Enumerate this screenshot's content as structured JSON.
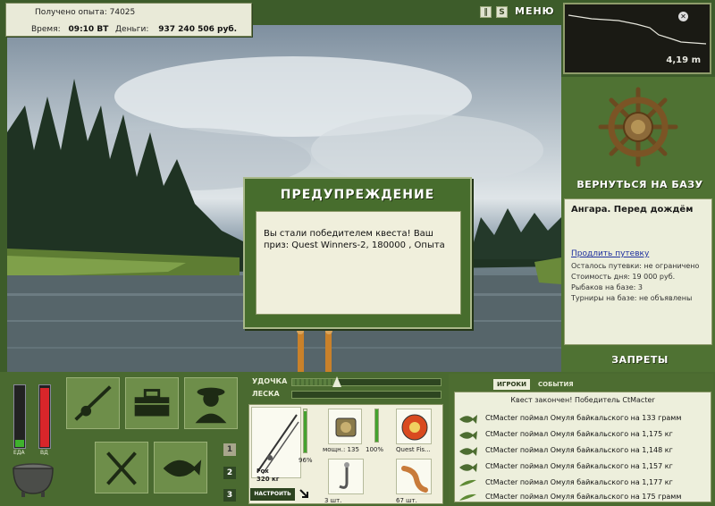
{
  "stats": {
    "exp_label": "Получено опыта:",
    "exp_value": "74025",
    "time_label": "Время:",
    "time_value": "09:10 ВТ",
    "money_label": "Деньги:",
    "money_value": "937 240 506 руб."
  },
  "top_menu": {
    "menu_label": "МЕНЮ",
    "pause_icon": "pause-icon",
    "sound_icon": "sound-icon"
  },
  "depth": {
    "value": "4,19 m"
  },
  "base": {
    "return_label": "ВЕРНУТЬСЯ НА БАЗУ",
    "location_title": "Ангара. Перед дождём",
    "extend_link": "Продлить путевку",
    "lines": [
      "Осталось путевки: не ограничено",
      "Стоимость дня: 19 000 руб.",
      "Рыбаков на базе: 3",
      "Турниры на базе: не объявлены"
    ],
    "bans_label": "ЗАПРЕТЫ"
  },
  "dialog": {
    "title": "ПРЕДУПРЕЖДЕНИЕ",
    "message": "Вы стали победителем квеста! Ваш приз: Quest Winners-2, 180000 , Опыта"
  },
  "gauges": {
    "food_label": "ЕДА",
    "vodka_label": "ВД",
    "food_level": 0.12,
    "vodka_level": 0.95
  },
  "page_buttons": [
    "1",
    "2",
    "3"
  ],
  "tackle": {
    "rod_label": "УДОЧКА",
    "line_label": "ЛЕСКА",
    "rod_tension": 0.3,
    "line_tension": 0.0,
    "rod_percent": "96%",
    "rod_name": "Fox",
    "rod_weight": "320 кг",
    "reel_power": "мощн.: 135",
    "reel_percent": "100%",
    "line_name": "Quest Fis...",
    "hook_count": "3 шт.",
    "bait_count": "67 шт.",
    "setup_label": "НАСТРОИТЬ"
  },
  "chat": {
    "tab_players": "ИГРОКИ",
    "tab_events": "СОБЫТИЯ",
    "header": "Квест закончен! Победитель CtMacter",
    "events": [
      "CtMacter поймал Омуля байкальского на 133 грамм",
      "CtMacter поймал Омуля байкальского на 1,175 кг",
      "CtMacter поймал Омуля байкальского на 1,148 кг",
      "CtMacter поймал Омуля байкальского на 1,157 кг",
      "CtMacter поймал Омуля байкальского на 1,177 кг",
      "CtMacter поймал Омуля байкальского на 175 грамм"
    ]
  },
  "colors": {
    "panel_green": "#4f7233",
    "panel_cream": "#eceedb",
    "accent_white": "#ffffff",
    "food_green": "#3fb22d",
    "vodka_red": "#d8262a"
  }
}
